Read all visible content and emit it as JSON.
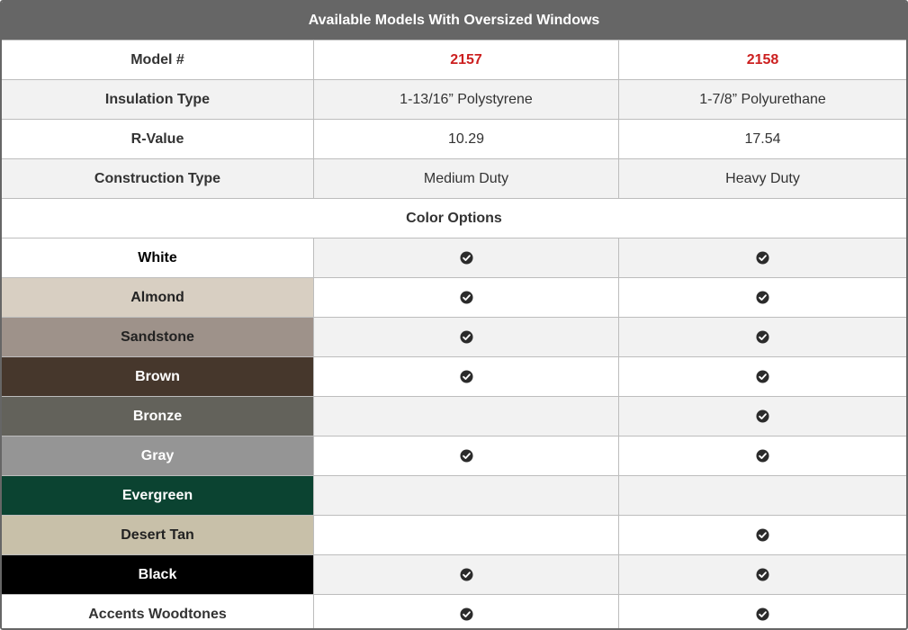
{
  "title": "Available Models With Oversized Windows",
  "rows": [
    {
      "label": "Model #",
      "col1": "2157",
      "col2": "2158"
    },
    {
      "label": "Insulation Type",
      "col1": "1-13/16” Polystyrene",
      "col2": "1-7/8” Polyurethane"
    },
    {
      "label": "R-Value",
      "col1": "10.29",
      "col2": "17.54"
    },
    {
      "label": "Construction Type",
      "col1": "Medium Duty",
      "col2": "Heavy Duty"
    }
  ],
  "color_options_label": "Color Options",
  "colors": [
    {
      "name": "White",
      "swatch": "#ffffff",
      "text_color": "#000000",
      "m2157": true,
      "m2158": true
    },
    {
      "name": "Almond",
      "swatch": "#d8cfc2",
      "text_color": "#222222",
      "m2157": true,
      "m2158": true
    },
    {
      "name": "Sandstone",
      "swatch": "#9e928a",
      "text_color": "#222222",
      "m2157": true,
      "m2158": true
    },
    {
      "name": "Brown",
      "swatch": "#46372c",
      "text_color": "#ffffff",
      "m2157": true,
      "m2158": true
    },
    {
      "name": "Bronze",
      "swatch": "#63625b",
      "text_color": "#ffffff",
      "m2157": false,
      "m2158": true
    },
    {
      "name": "Gray",
      "swatch": "#959595",
      "text_color": "#ffffff",
      "m2157": true,
      "m2158": true
    },
    {
      "name": "Evergreen",
      "swatch": "#0b4331",
      "text_color": "#ffffff",
      "m2157": false,
      "m2158": false
    },
    {
      "name": "Desert Tan",
      "swatch": "#c8c0a9",
      "text_color": "#222222",
      "m2157": false,
      "m2158": true
    },
    {
      "name": "Black",
      "swatch": "#000000",
      "text_color": "#ffffff",
      "m2157": true,
      "m2158": true
    },
    {
      "name": "Accents Woodtones",
      "swatch": "#ffffff",
      "text_color": "#333333",
      "m2157": true,
      "m2158": true
    }
  ],
  "check_icon": "check-circle-icon",
  "colors_theme": {
    "header_bg": "#666666",
    "model_number_color": "#cc1f1f"
  }
}
